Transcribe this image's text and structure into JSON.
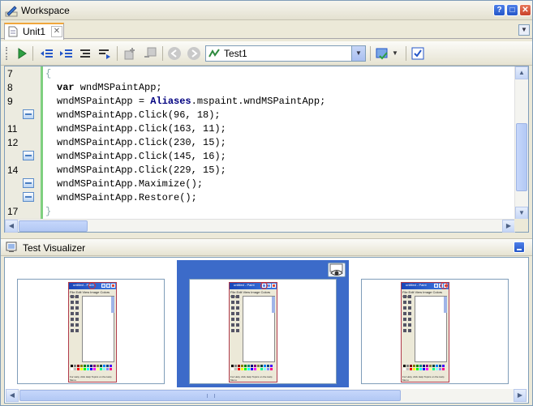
{
  "window": {
    "title": "Workspace",
    "title_icon": "pencil-icon",
    "buttons": [
      "help-icon",
      "maximize-icon",
      "close-icon"
    ]
  },
  "tabs": [
    {
      "label": "Unit1",
      "icon": "document-icon",
      "active": true
    }
  ],
  "toolbar": {
    "buttons": [
      "run-icon",
      "outdent-icon",
      "indent-icon",
      "align-icon",
      "wrap-icon",
      "add-checkpoint-icon",
      "remove-checkpoint-icon",
      "back-icon",
      "forward-icon",
      "bug-report-icon",
      "checklist-icon"
    ],
    "routine_combo": {
      "icon": "routine-icon",
      "value": "Test1"
    }
  },
  "editor": {
    "line_numbers": [
      "7",
      "8",
      "9",
      "",
      "11",
      "12",
      "",
      "14",
      "",
      "",
      "17"
    ],
    "checkpoint_rows": [
      3,
      6,
      8,
      9
    ],
    "brace_open": "{",
    "brace_close": "}",
    "lines": [
      {
        "kw": "var",
        "rest": " wndMSPaintApp;"
      },
      {
        "pre": "wndMSPaintApp = ",
        "obj": "Aliases",
        "post": ".mspaint.wndMSPaintApp;"
      },
      {
        "text": "wndMSPaintApp.Click(96, 18);"
      },
      {
        "text": "wndMSPaintApp.Click(163, 11);"
      },
      {
        "text": "wndMSPaintApp.Click(230, 15);"
      },
      {
        "text": "wndMSPaintApp.Click(145, 16);"
      },
      {
        "text": "wndMSPaintApp.Click(229, 15);"
      },
      {
        "text": "wndMSPaintApp.Maximize();"
      },
      {
        "text": "wndMSPaintApp.Restore();"
      }
    ]
  },
  "visualizer": {
    "title": "Test Visualizer",
    "icon": "visualizer-icon",
    "frames": [
      {
        "window_title": "untitled - Paint",
        "selected": false
      },
      {
        "window_title": "untitled - Paint",
        "selected": true
      },
      {
        "window_title": "untitled - Paint",
        "selected": false
      }
    ],
    "menu_text": "File  Edit  View  Image  Colors  Help",
    "status_text": "For Help, click Help Topics on the Help Menu.",
    "preview_icon": "eye-icon"
  },
  "colors": {
    "accent": "#3c6bc9",
    "gutter_bar": "#7fd07f",
    "tab_highlight": "#f0a63c"
  }
}
